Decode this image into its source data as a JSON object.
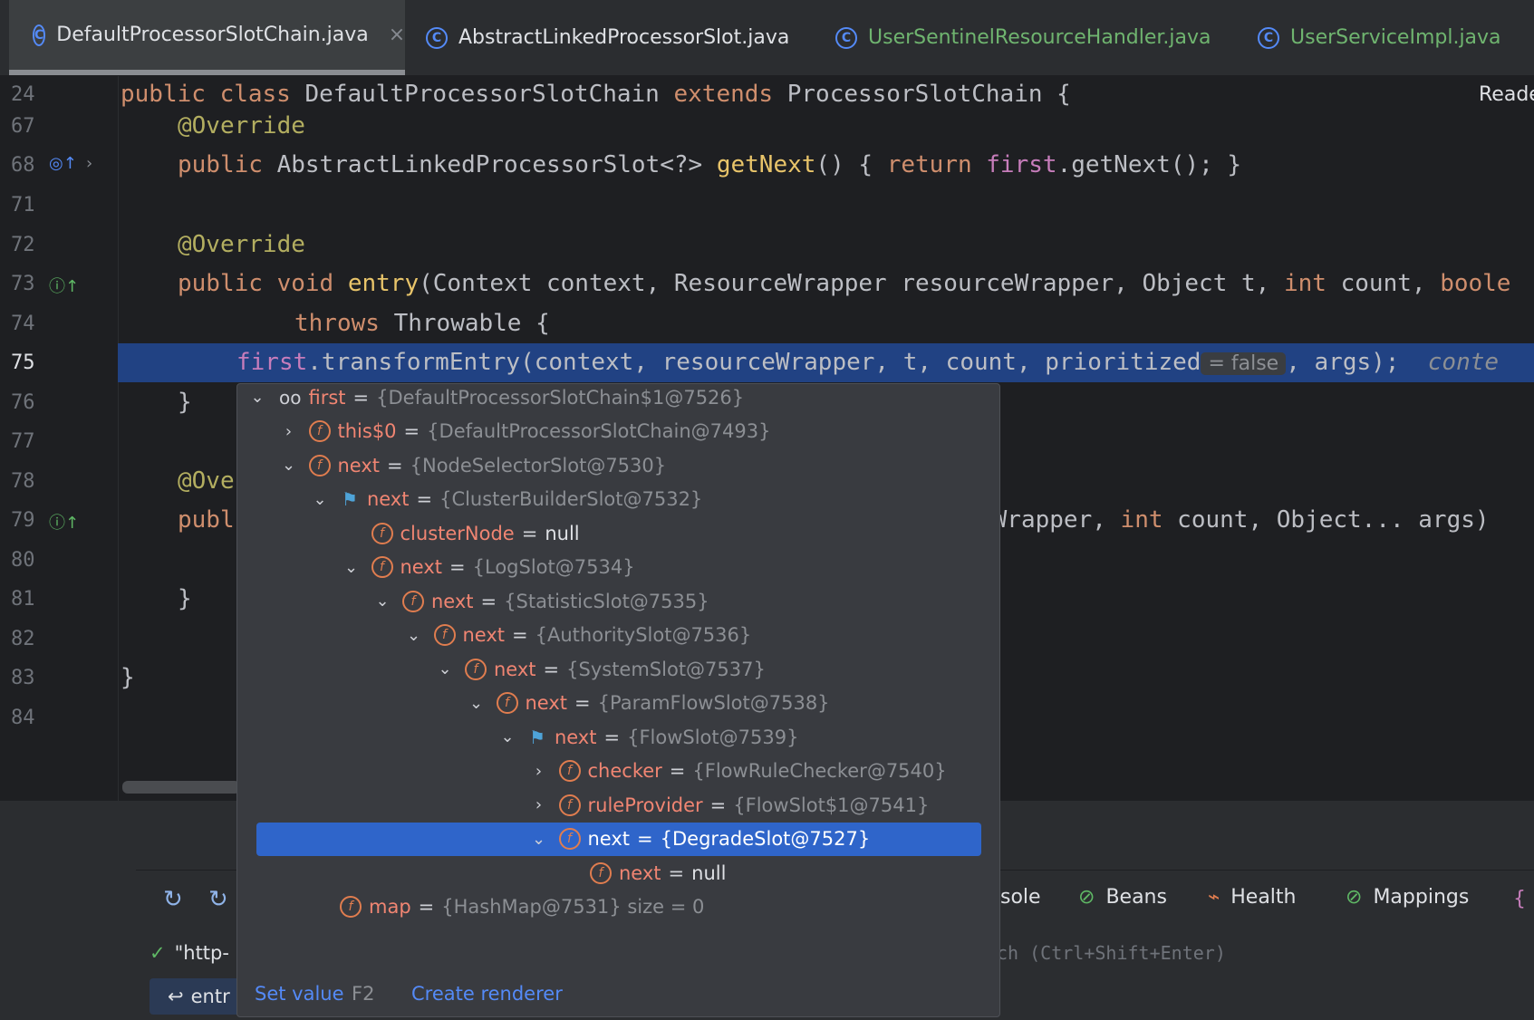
{
  "tabs": [
    {
      "label": "DefaultProcessorSlotChain.java",
      "active": true
    },
    {
      "label": "AbstractLinkedProcessorSlot.java",
      "active": false
    },
    {
      "label": "UserSentinelResourceHandler.java",
      "active": false
    },
    {
      "label": "UserServiceImpl.java",
      "active": false
    }
  ],
  "tab_close": "×",
  "reader_mode": "Reade",
  "line_numbers": [
    "24",
    "67",
    "68",
    "71",
    "72",
    "73",
    "74",
    "75",
    "76",
    "77",
    "78",
    "79",
    "80",
    "81",
    "82",
    "83",
    "84"
  ],
  "code": {
    "l24_kw": "public class ",
    "l24_name": "DefaultProcessorSlotChain ",
    "l24_kw2": "extends ",
    "l24_rest": "ProcessorSlotChain {",
    "l67": "@Override",
    "l68_kw": "public ",
    "l68_type": "AbstractLinkedProcessorSlot<?> ",
    "l68_fn": "getNext",
    "l68_a": "() { ",
    "l68_ret": "return ",
    "l68_first": "first",
    "l68_b": ".getNext(); }",
    "l72": "@Override",
    "l73_kw": "public void ",
    "l73_fn": "entry",
    "l73_rest": "(Context context, ResourceWrapper resourceWrapper, Object t, ",
    "l73_int": "int ",
    "l73_rest2": "count, ",
    "l73_bool": "boole",
    "l74_kw": "throws ",
    "l74_rest": "Throwable {",
    "l75_first": "first",
    "l75_rest": ".transformEntry(context, resourceWrapper, t, count, prioritized",
    "l75_inlay": "= false",
    "l75_rest2": ", args);",
    "l75_hint": "conte",
    "l76": "}",
    "l78": "@Ove",
    "l79_kw": "publ",
    "l79_rest": "eWrapper, ",
    "l79_int": "int ",
    "l79_rest2": "count, Object... args)",
    "l81": "}",
    "l83": "}"
  },
  "popup": {
    "rows": [
      {
        "name": "first",
        "eq": "=",
        "value": "{DefaultProcessorSlotChain$1@7526}",
        "icon": "glasses",
        "chev": "⌄",
        "indent": 0
      },
      {
        "name": "this$0",
        "eq": "=",
        "value": "{DefaultProcessorSlotChain@7493}",
        "icon": "field",
        "chev": "›",
        "indent": 1
      },
      {
        "name": "next",
        "eq": "=",
        "value": "{NodeSelectorSlot@7530}",
        "icon": "field",
        "chev": "⌄",
        "indent": 1
      },
      {
        "name": "next",
        "eq": "=",
        "value": "{ClusterBuilderSlot@7532}",
        "icon": "flag",
        "chev": "⌄",
        "indent": 2
      },
      {
        "name": "clusterNode",
        "eq": "=",
        "value": "null",
        "icon": "field",
        "chev": "",
        "indent": 3
      },
      {
        "name": "next",
        "eq": "=",
        "value": "{LogSlot@7534}",
        "icon": "field",
        "chev": "⌄",
        "indent": 3
      },
      {
        "name": "next",
        "eq": "=",
        "value": "{StatisticSlot@7535}",
        "icon": "field",
        "chev": "⌄",
        "indent": 4
      },
      {
        "name": "next",
        "eq": "=",
        "value": "{AuthoritySlot@7536}",
        "icon": "field",
        "chev": "⌄",
        "indent": 5
      },
      {
        "name": "next",
        "eq": "=",
        "value": "{SystemSlot@7537}",
        "icon": "field",
        "chev": "⌄",
        "indent": 6
      },
      {
        "name": "next",
        "eq": "=",
        "value": "{ParamFlowSlot@7538}",
        "icon": "field",
        "chev": "⌄",
        "indent": 7
      },
      {
        "name": "next",
        "eq": "=",
        "value": "{FlowSlot@7539}",
        "icon": "flag",
        "chev": "⌄",
        "indent": 8
      },
      {
        "name": "checker",
        "eq": "=",
        "value": "{FlowRuleChecker@7540}",
        "icon": "field",
        "chev": "›",
        "indent": 9
      },
      {
        "name": "ruleProvider",
        "eq": "=",
        "value": "{FlowSlot$1@7541}",
        "icon": "field",
        "chev": "›",
        "indent": 9
      },
      {
        "name": "next",
        "eq": "=",
        "value": "{DegradeSlot@7527}",
        "icon": "field",
        "chev": "⌄",
        "indent": 9,
        "selected": true
      },
      {
        "name": "next",
        "eq": "=",
        "value": "null",
        "icon": "field",
        "chev": "",
        "indent": 10
      },
      {
        "name": "map",
        "eq": "=",
        "value": "{HashMap@7531}  size = 0",
        "icon": "field",
        "chev": "",
        "indent": 2
      }
    ],
    "set_value": "Set value",
    "set_value_key": "F2",
    "create_renderer": "Create renderer"
  },
  "bottom": {
    "console": "sole",
    "beans": "Beans",
    "health": "Health",
    "mappings": "Mappings",
    "frame_text": "\"http-",
    "frame_entry": "entr",
    "eval_hint": "ch (Ctrl+Shift+Enter)"
  },
  "colors": {
    "accent": "#2f65ca",
    "selection_line": "#214283",
    "keyword": "#cf8e6d",
    "field_icon": "#e07d4f"
  }
}
